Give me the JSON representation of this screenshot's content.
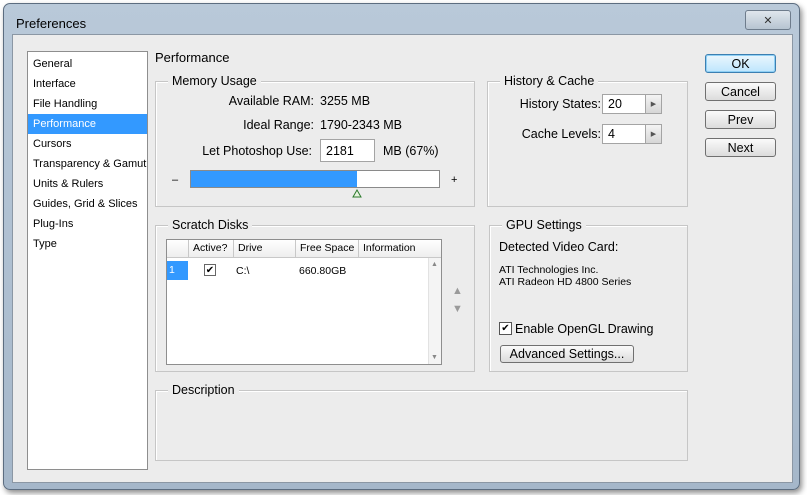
{
  "window": {
    "title": "Preferences",
    "close_glyph": "✕"
  },
  "sidebar": {
    "items": [
      {
        "label": "General",
        "selected": false
      },
      {
        "label": "Interface",
        "selected": false
      },
      {
        "label": "File Handling",
        "selected": false
      },
      {
        "label": "Performance",
        "selected": true
      },
      {
        "label": "Cursors",
        "selected": false
      },
      {
        "label": "Transparency & Gamut",
        "selected": false
      },
      {
        "label": "Units & Rulers",
        "selected": false
      },
      {
        "label": "Guides, Grid & Slices",
        "selected": false
      },
      {
        "label": "Plug-Ins",
        "selected": false
      },
      {
        "label": "Type",
        "selected": false
      }
    ]
  },
  "page_title": "Performance",
  "memory": {
    "title": "Memory Usage",
    "available_label": "Available RAM:",
    "available_value": "3255 MB",
    "ideal_label": "Ideal Range:",
    "ideal_value": "1790-2343 MB",
    "use_label": "Let Photoshop Use:",
    "use_value": "2181",
    "use_suffix": "MB (67%)",
    "slider_percent": 67,
    "minus": "–",
    "plus": "+"
  },
  "history": {
    "title": "History & Cache",
    "states_label": "History States:",
    "states_value": "20",
    "levels_label": "Cache Levels:",
    "levels_value": "4"
  },
  "scratch": {
    "title": "Scratch Disks",
    "columns": [
      "Active?",
      "Drive",
      "Free Space",
      "Information"
    ],
    "rows": [
      {
        "index": "1",
        "active": "✔",
        "drive": "C:\\",
        "free": "660.80GB",
        "info": ""
      }
    ],
    "up_arrow": "▲",
    "down_arrow": "▼"
  },
  "gpu": {
    "title": "GPU Settings",
    "detected_label": "Detected Video Card:",
    "vendor": "ATI Technologies Inc.",
    "model": "ATI Radeon HD 4800 Series",
    "opengl_label": "Enable OpenGL Drawing",
    "opengl_checked": true,
    "check_glyph": "✔",
    "advanced_label": "Advanced Settings..."
  },
  "description": {
    "title": "Description"
  },
  "buttons": {
    "ok": "OK",
    "cancel": "Cancel",
    "prev": "Prev",
    "next": "Next"
  },
  "colors": {
    "accent": "#3399ff",
    "dialog_bg": "#ececec"
  }
}
